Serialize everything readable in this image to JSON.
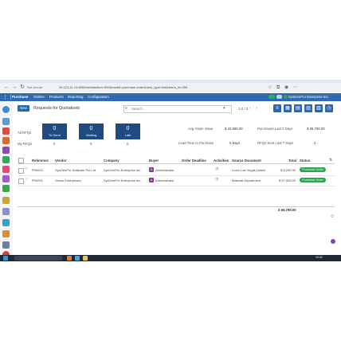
{
  "browser": {
    "security_label": "Not secure",
    "url": "20.121.41.15:8069/web#action=550&model=purchase.order&view_type=list&menu_id=350",
    "toolbar_icons": [
      "back-icon",
      "forward-icon",
      "reload-icon",
      "star-icon",
      "extensions-icon",
      "profile-icon",
      "more-icon"
    ]
  },
  "topnav": {
    "app_name": "Purchase",
    "menu": [
      "Orders",
      "Products",
      "Reporting",
      "Configuration"
    ],
    "company": "SysGenPro Enterprise Inc."
  },
  "control_panel": {
    "new_label": "New",
    "title": "Requests for Quotation",
    "search_placeholder": "Search...",
    "pager": "1-2 / 2"
  },
  "dashboard": {
    "all_rfqs_label": "All RFQs",
    "my_rfqs_label": "My RFQs",
    "cards": [
      {
        "value": "0",
        "label": "To Send"
      },
      {
        "value": "0",
        "label": "Waiting"
      },
      {
        "value": "0",
        "label": "Late"
      }
    ],
    "my_values": [
      "0",
      "0",
      "0"
    ],
    "kpis": {
      "avg_order_label": "Avg Order Value",
      "avg_order_value": "$ 32,890.00",
      "purchased_label": "Purchased Last 7 Days",
      "purchased_value": "$ 65,780.00",
      "lead_time_label": "Lead Time to Purchase",
      "lead_time_value": "0 Days",
      "rfqs_sent_label": "RFQs Sent Last 7 Days",
      "rfqs_sent_value": "2"
    }
  },
  "table": {
    "columns": [
      "Reference",
      "Vendor",
      "Company",
      "Buyer",
      "Order Deadline",
      "Activities",
      "Source Document",
      "Total",
      "Status"
    ],
    "rows": [
      {
        "reference": "P00002",
        "vendor": "SysGenPro Software Pvt Ltd",
        "company": "SysGenPro Enterprise Inc.",
        "buyer_initial": "A",
        "buyer": "Administrator",
        "source": "Luxor Las Vegas Hotels",
        "total": "$ 8,250.00",
        "status": "Purchase Order"
      },
      {
        "reference": "P00001",
        "vendor": "Venus Enterprises",
        "company": "SysGenPro Enterprise Inc.",
        "buyer_initial": "A",
        "buyer": "Administrator",
        "source": "Material Department",
        "total": "$ 57,500.00",
        "status": "Purchase Order"
      }
    ],
    "grand_total": "$ 65,780.00"
  },
  "taskbar": {
    "time": "10:22"
  },
  "colors": {
    "brand": "#2f6bb0",
    "card": "#204a82",
    "status_green": "#27a64b",
    "avatar_purple": "#8b3a87"
  }
}
